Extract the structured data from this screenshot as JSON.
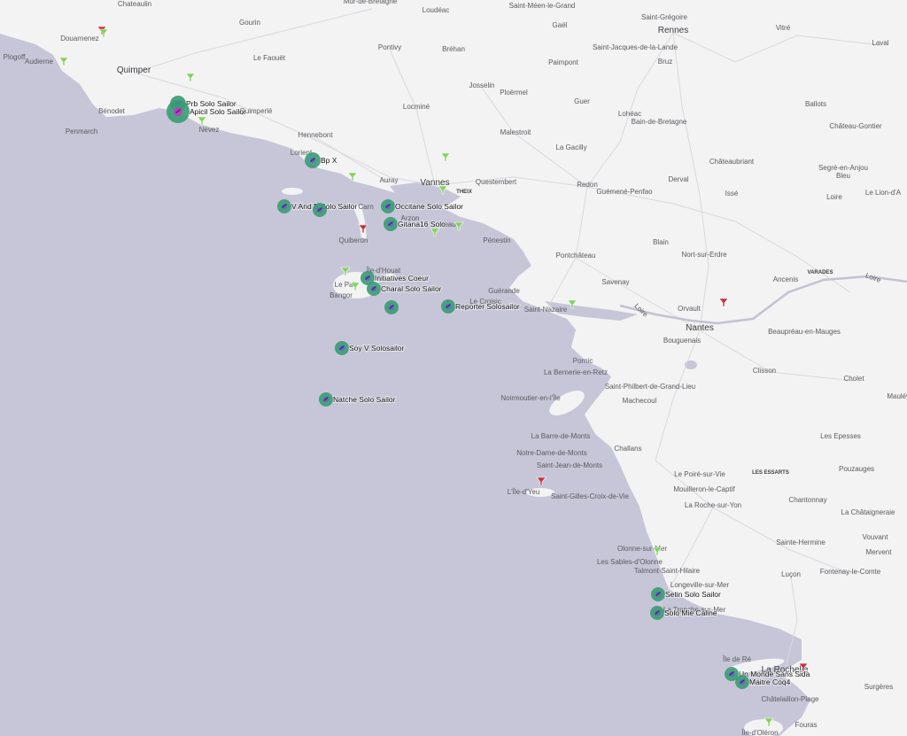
{
  "colors": {
    "land": "#f3f3f4",
    "sea": "#c7c6d8",
    "road": "#d7d7dc",
    "boat_ring": "#3a9a73",
    "boat_fill": "#6e63c8",
    "boat_highlight": "#cc33cc",
    "poi_green": "#7fd35a",
    "poi_red": "#c9303a"
  },
  "places": [
    {
      "id": "chateaulin",
      "label": "Chateaulin"
    },
    {
      "id": "mur-de-bretagne",
      "label": "Mûr-de-Bretagne"
    },
    {
      "id": "loudeac",
      "label": "Loudéac"
    },
    {
      "id": "saint-meen",
      "label": "Saint-Méen-le-Grand"
    },
    {
      "id": "saint-gregoire",
      "label": "Saint-Grégoire"
    },
    {
      "id": "rennes",
      "label": "Rennes"
    },
    {
      "id": "vitre",
      "label": "Vitré"
    },
    {
      "id": "laval",
      "label": "Laval"
    },
    {
      "id": "douarnenez",
      "label": "Douarnenez"
    },
    {
      "id": "gourin",
      "label": "Gourin"
    },
    {
      "id": "gael",
      "label": "Gaël"
    },
    {
      "id": "saint-jacques",
      "label": "Saint-Jacques-de-la-Lande"
    },
    {
      "id": "plogoff",
      "label": "Plogoff"
    },
    {
      "id": "audierne",
      "label": "Audierne"
    },
    {
      "id": "quimper",
      "label": "Quimper"
    },
    {
      "id": "le-faouet",
      "label": "Le Faouët"
    },
    {
      "id": "pontivy",
      "label": "Pontivy"
    },
    {
      "id": "brehan",
      "label": "Bréhan"
    },
    {
      "id": "paimpont",
      "label": "Paimpont"
    },
    {
      "id": "bruz",
      "label": "Bruz"
    },
    {
      "id": "josselin",
      "label": "Josselin"
    },
    {
      "id": "ploermel",
      "label": "Ploërmel"
    },
    {
      "id": "benodet",
      "label": "Bénodet"
    },
    {
      "id": "quimperle",
      "label": "Quimperlé"
    },
    {
      "id": "locmine",
      "label": "Locminé"
    },
    {
      "id": "guer",
      "label": "Guer"
    },
    {
      "id": "ballots",
      "label": "Ballots"
    },
    {
      "id": "loheac",
      "label": "Lohéac"
    },
    {
      "id": "bain-de-bretagne",
      "label": "Bain-de-Bretagne"
    },
    {
      "id": "penmarch",
      "label": "Penmarch"
    },
    {
      "id": "nevez",
      "label": "Névez"
    },
    {
      "id": "chateau-gontier",
      "label": "Château-Gontier"
    },
    {
      "id": "hennebont",
      "label": "Hennebont"
    },
    {
      "id": "malestroit",
      "label": "Malestroit"
    },
    {
      "id": "la-gacilly",
      "label": "La Gacilly"
    },
    {
      "id": "lorient",
      "label": "Lorient"
    },
    {
      "id": "chateaubriant",
      "label": "Châteaubriant"
    },
    {
      "id": "segre",
      "label": "Segré-en-Anjou\nBleu"
    },
    {
      "id": "auray",
      "label": "Auray"
    },
    {
      "id": "vannes",
      "label": "Vannes"
    },
    {
      "id": "questembert",
      "label": "Questembert"
    },
    {
      "id": "redon",
      "label": "Redon"
    },
    {
      "id": "derval",
      "label": "Derval"
    },
    {
      "id": "theix",
      "label": "THEIX"
    },
    {
      "id": "guemene",
      "label": "Guémené-Penfao"
    },
    {
      "id": "isse",
      "label": "Issé"
    },
    {
      "id": "loire-town",
      "label": "Loire"
    },
    {
      "id": "le-lion",
      "label": "Le Lion-d'A"
    },
    {
      "id": "carnac",
      "label": "Carn"
    },
    {
      "id": "arzon",
      "label": "Arzon"
    },
    {
      "id": "sarzeau",
      "label": "zeau"
    },
    {
      "id": "quiberon",
      "label": "Quiberon"
    },
    {
      "id": "penestin",
      "label": "Pénestin"
    },
    {
      "id": "blain",
      "label": "Blain"
    },
    {
      "id": "nort-sur-erdre",
      "label": "Nort-sur-Erdre"
    },
    {
      "id": "ile-d-houat",
      "label": "Île-d'Houat"
    },
    {
      "id": "pontchateau",
      "label": "Pontchâteau"
    },
    {
      "id": "varades",
      "label": "VARADES"
    },
    {
      "id": "le-palais",
      "label": "Le Pal"
    },
    {
      "id": "bangor",
      "label": "Bangor"
    },
    {
      "id": "ancenis",
      "label": "Ancenis"
    },
    {
      "id": "loire-river-east",
      "label": "Loire"
    },
    {
      "id": "guerande",
      "label": "Guérande"
    },
    {
      "id": "savenay",
      "label": "Savenay"
    },
    {
      "id": "le-croisic",
      "label": "Le Croisic"
    },
    {
      "id": "saint-nazaire",
      "label": "Saint-Nazaire"
    },
    {
      "id": "orvault",
      "label": "Orvault"
    },
    {
      "id": "loire-river-west",
      "label": "Loire"
    },
    {
      "id": "nantes",
      "label": "Nantes"
    },
    {
      "id": "bouguenais",
      "label": "Bouguenais"
    },
    {
      "id": "beaupreau",
      "label": "Beaupréau-en-Mauges"
    },
    {
      "id": "pornic",
      "label": "Pornic"
    },
    {
      "id": "la-bernerie",
      "label": "La Bernerie-en-Retz"
    },
    {
      "id": "clisson",
      "label": "Clisson"
    },
    {
      "id": "saint-philbert",
      "label": "Saint-Philbert-de-Grand-Lieu"
    },
    {
      "id": "cholet",
      "label": "Cholet"
    },
    {
      "id": "maulevrier",
      "label": "Maulévrier"
    },
    {
      "id": "noirmoutier",
      "label": "Noirmoutier-en-l'Île"
    },
    {
      "id": "machecoul",
      "label": "Machecoul"
    },
    {
      "id": "la-barre-de-monts",
      "label": "La Barre-de-Monts"
    },
    {
      "id": "les-epesses",
      "label": "Les Epesses"
    },
    {
      "id": "challans",
      "label": "Challans"
    },
    {
      "id": "notre-dame-de-monts",
      "label": "Notre-Dame-de-Monts"
    },
    {
      "id": "saint-jean-de-monts",
      "label": "Saint-Jean-de-Monts"
    },
    {
      "id": "pouzauges",
      "label": "Pouzauges"
    },
    {
      "id": "le-poire",
      "label": "Le Poiré-sur-Vie"
    },
    {
      "id": "les-essarts",
      "label": "LES ESSARTS"
    },
    {
      "id": "mouilleron",
      "label": "Mouilleron-le-Captif"
    },
    {
      "id": "ile-d-yeu",
      "label": "L'Île-d'Yeu"
    },
    {
      "id": "saint-gilles",
      "label": "Saint-Gilles-Croix-de-Vie"
    },
    {
      "id": "chantonnay",
      "label": "Chantonnay"
    },
    {
      "id": "la-roche-sur-yon",
      "label": "La Roche-sur-Yon"
    },
    {
      "id": "la-chataigneraie",
      "label": "La Châtaigneraie"
    },
    {
      "id": "sainte-hermine",
      "label": "Sainte-Hermine"
    },
    {
      "id": "vouvant",
      "label": "Vouvant"
    },
    {
      "id": "olonne",
      "label": "Olonne-sur-Mer"
    },
    {
      "id": "mervent",
      "label": "Mervent"
    },
    {
      "id": "les-sables",
      "label": "Les Sables-d'Olonne"
    },
    {
      "id": "talmont",
      "label": "Talmont-Saint-Hilaire"
    },
    {
      "id": "lucon",
      "label": "Luçon"
    },
    {
      "id": "fontenay",
      "label": "Fontenay-le-Comte"
    },
    {
      "id": "longeville",
      "label": "Longeville-sur-Mer"
    },
    {
      "id": "la-tranche",
      "label": "La Tranche-sur-Mer"
    },
    {
      "id": "ile-de-re",
      "label": "Île de Ré"
    },
    {
      "id": "la-rochelle",
      "label": "La Rochelle"
    },
    {
      "id": "surgeres",
      "label": "Surgères"
    },
    {
      "id": "chatelaillon",
      "label": "Châtelaillon-Plage"
    },
    {
      "id": "fouras",
      "label": "Fouras"
    },
    {
      "id": "ile-d-oleron",
      "label": "Île-d'Oléron"
    }
  ],
  "boats": [
    {
      "name": "Prb Solo Sailor",
      "highlight": false
    },
    {
      "name": "Apicil Solo Sailor",
      "highlight": true
    },
    {
      "name": "Bp X",
      "highlight": false
    },
    {
      "name": "V And B Solo Sailor",
      "highlight": false
    },
    {
      "name": "Occitane Solo Sailor",
      "highlight": false
    },
    {
      "name": "Gitana16 Solo",
      "highlight": false
    },
    {
      "name": "Initiatives Coeur",
      "highlight": false
    },
    {
      "name": "Charal Solo Sailor",
      "highlight": false
    },
    {
      "name": "Reporter Solosailor",
      "highlight": false
    },
    {
      "name": "Soy V Solosailor",
      "highlight": false
    },
    {
      "name": "Natche Solo Sailor",
      "highlight": false
    },
    {
      "name": "Setin Solo Sailor",
      "highlight": false
    },
    {
      "name": "Solo Mie Caline",
      "highlight": false
    },
    {
      "name": "Un Monde Sans Sida",
      "highlight": false
    },
    {
      "name": "Maitre Coq4",
      "highlight": false
    },
    {
      "name": "",
      "highlight": false
    },
    {
      "name": "",
      "highlight": false
    }
  ],
  "pois": [
    {
      "type": "green"
    },
    {
      "type": "red"
    },
    {
      "type": "green"
    },
    {
      "type": "green"
    },
    {
      "type": "green"
    },
    {
      "type": "green"
    },
    {
      "type": "green"
    },
    {
      "type": "green"
    },
    {
      "type": "green"
    },
    {
      "type": "red"
    },
    {
      "type": "green"
    },
    {
      "type": "green"
    },
    {
      "type": "green"
    },
    {
      "type": "red"
    },
    {
      "type": "red"
    },
    {
      "type": "green"
    },
    {
      "type": "red"
    },
    {
      "type": "green"
    },
    {
      "type": "green"
    }
  ]
}
